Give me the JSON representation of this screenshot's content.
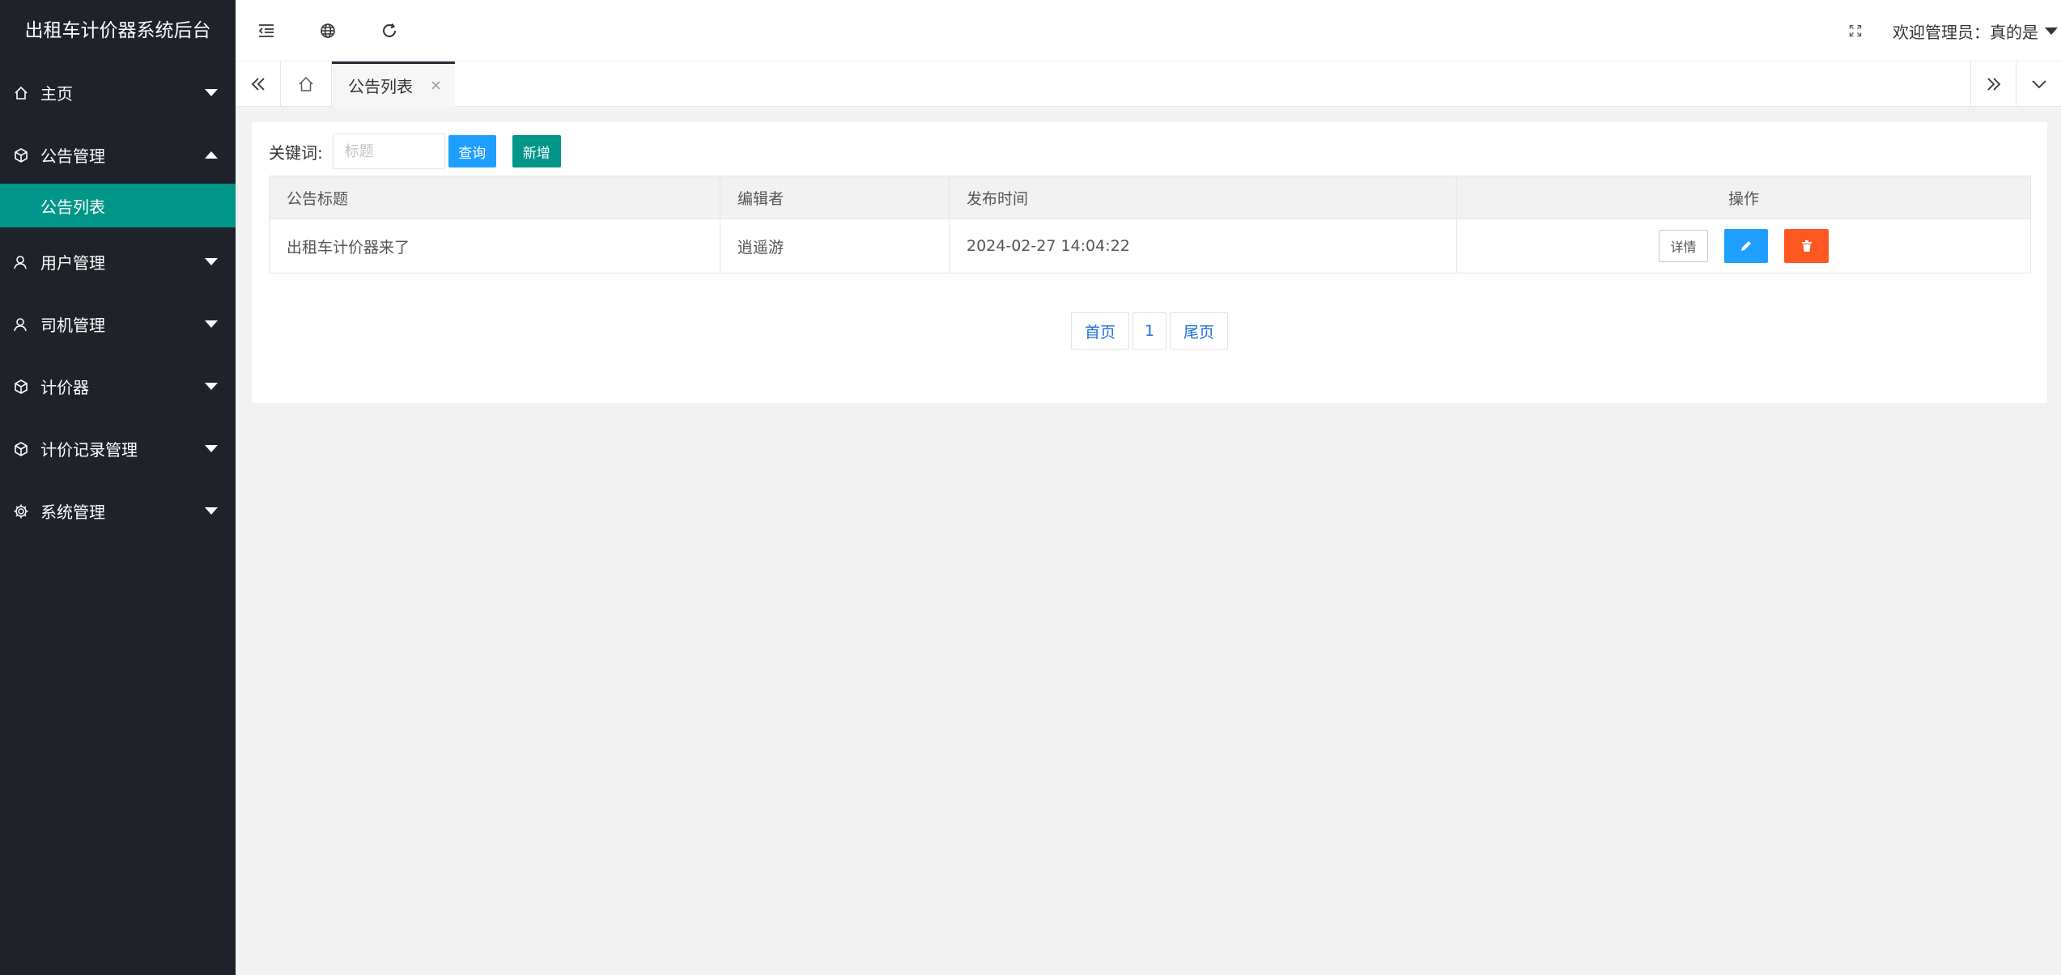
{
  "sidebar": {
    "logo": "出租车计价器系统后台",
    "items": [
      {
        "label": "主页"
      },
      {
        "label": "公告管理"
      },
      {
        "label": "用户管理"
      },
      {
        "label": "司机管理"
      },
      {
        "label": "计价器"
      },
      {
        "label": "计价记录管理"
      },
      {
        "label": "系统管理"
      }
    ],
    "sub_item": "公告列表"
  },
  "header": {
    "welcome": "欢迎管理员：真的是"
  },
  "tabs": {
    "active": "公告列表",
    "close": "×"
  },
  "search": {
    "label": "关键词:",
    "placeholder": "标题",
    "query_label": "查询",
    "add_label": "新增"
  },
  "table": {
    "columns": [
      "公告标题",
      "编辑者",
      "发布时间",
      "操作"
    ],
    "rows": [
      {
        "title": "出租车计价器来了",
        "editor": "逍遥游",
        "time": "2024-02-27 14:04:22",
        "detail_label": "详情"
      }
    ]
  },
  "pager": {
    "first": "首页",
    "page": "1",
    "last": "尾页"
  },
  "colors": {
    "sidebar_bg": "#20222a",
    "accent_green": "#009688",
    "accent_blue": "#1e9fff",
    "danger": "#ff5722"
  }
}
